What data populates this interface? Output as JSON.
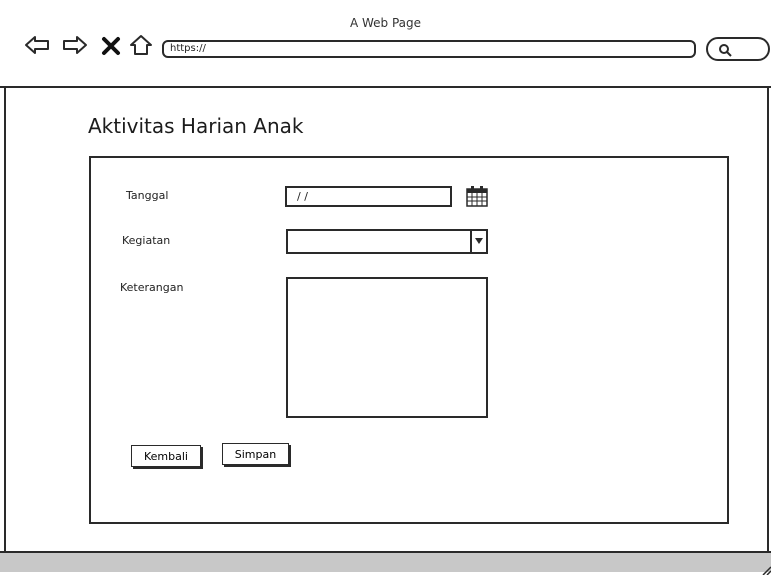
{
  "window": {
    "title": "A Web Page"
  },
  "browser": {
    "url": "https://",
    "icons": [
      "back-arrow-icon",
      "forward-arrow-icon",
      "close-x-icon",
      "home-icon",
      "search-icon"
    ]
  },
  "page": {
    "title": "Aktivitas Harian Anak"
  },
  "form": {
    "tanggal": {
      "label": "Tanggal",
      "value": "/ /",
      "icon": "calendar-icon"
    },
    "kegiatan": {
      "label": "Kegiatan",
      "value": ""
    },
    "keterangan": {
      "label": "Keterangan",
      "value": ""
    },
    "buttons": {
      "kembali": "Kembali",
      "simpan": "Simpan"
    }
  },
  "colors": {
    "stroke": "#2a2a2a",
    "status_bar": "#c8c8c8",
    "background": "#ffffff"
  }
}
